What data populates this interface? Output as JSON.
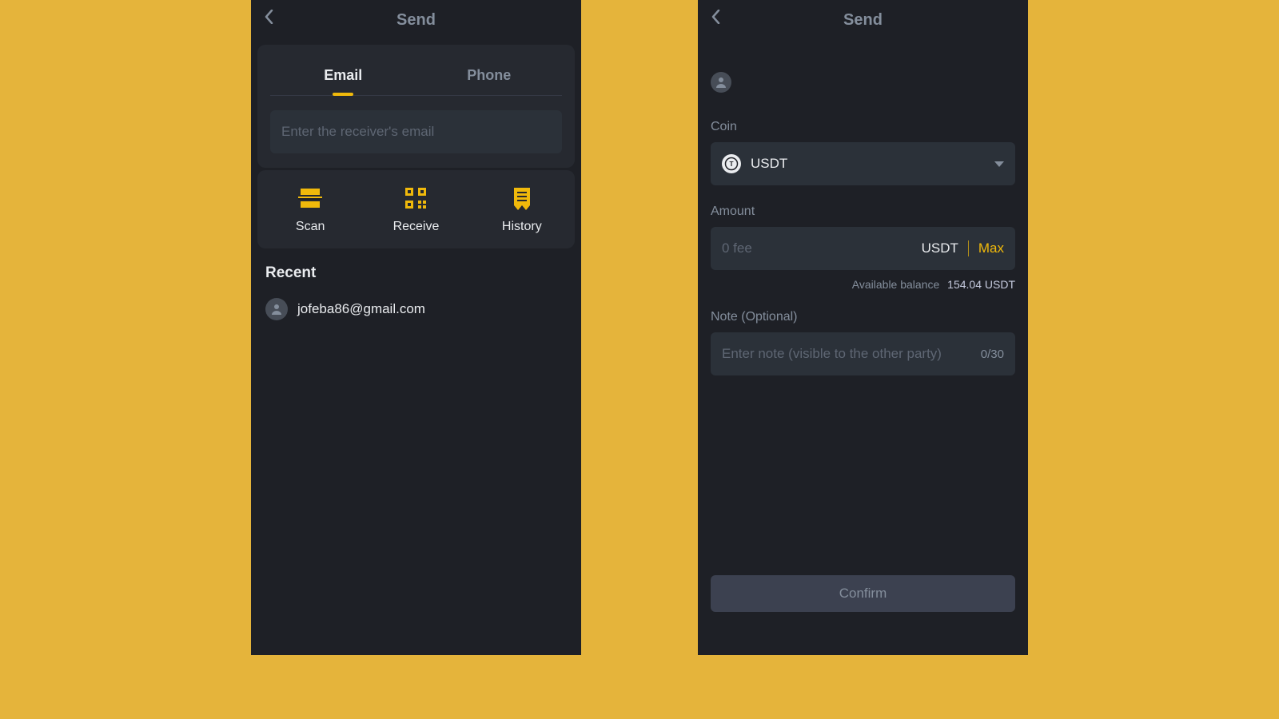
{
  "colors": {
    "accent": "#f0b90b",
    "bg": "#1e2026",
    "panel": "#2b3139"
  },
  "left": {
    "title": "Send",
    "tabs": {
      "email": "Email",
      "phone": "Phone",
      "active": "email"
    },
    "email_placeholder": "Enter the receiver's email",
    "actions": {
      "scan": "Scan",
      "receive": "Receive",
      "history": "History"
    },
    "recent_title": "Recent",
    "recent": [
      {
        "email": "jofeba86@gmail.com"
      }
    ]
  },
  "right": {
    "title": "Send",
    "coin_label": "Coin",
    "coin": {
      "symbol": "USDT",
      "glyph": "T"
    },
    "amount_label": "Amount",
    "amount_placeholder": "0 fee",
    "unit": "USDT",
    "max": "Max",
    "balance_label": "Available balance",
    "balance_value": "154.04 USDT",
    "note_label": "Note (Optional)",
    "note_placeholder": "Enter note (visible to the other party)",
    "note_counter": "0/30",
    "confirm": "Confirm"
  }
}
